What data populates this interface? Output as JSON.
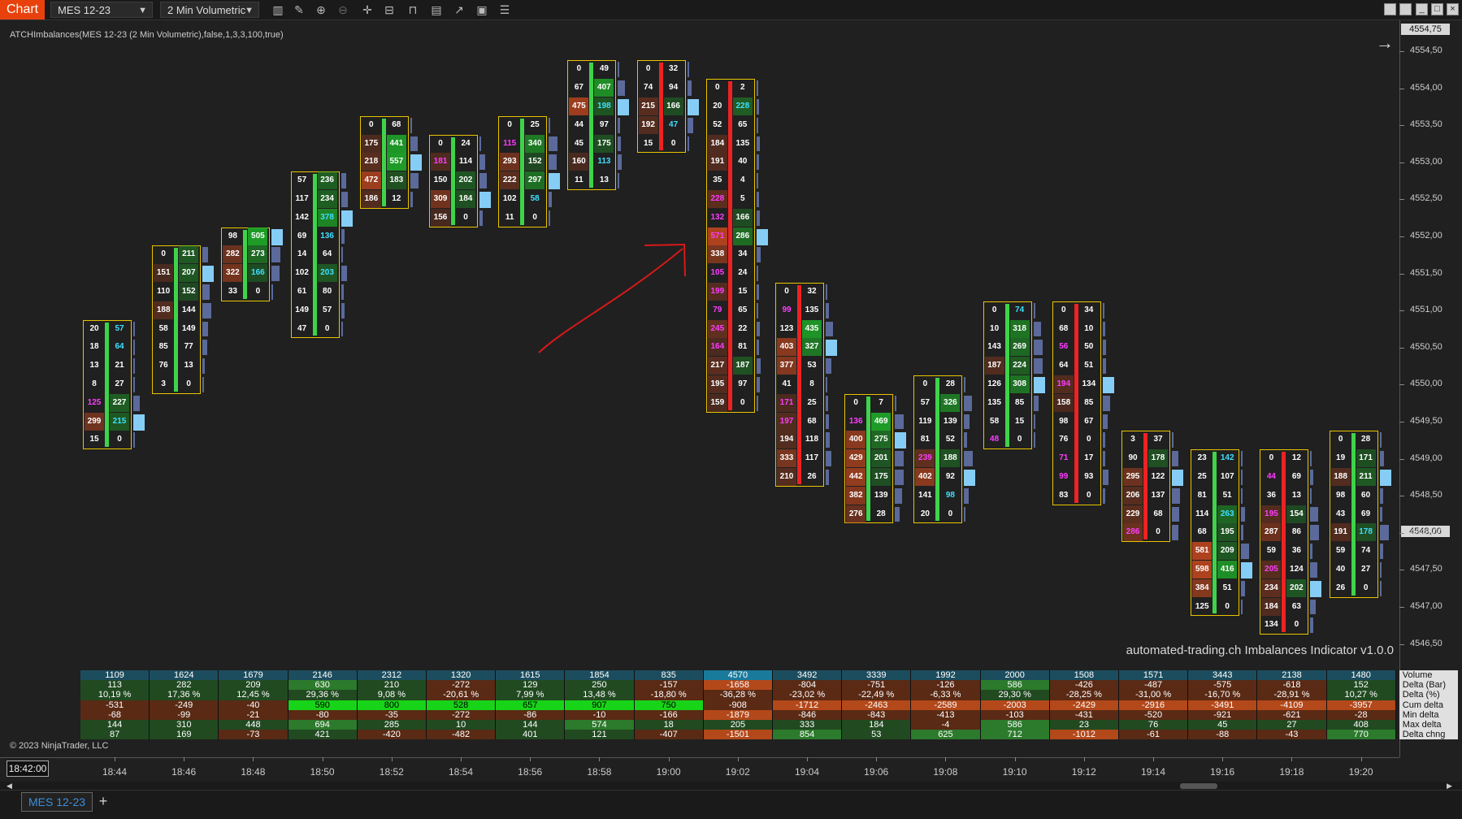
{
  "toolbar": {
    "tab_label": "Chart",
    "instrument": "MES 12-23",
    "bar_type": "2 Min Volumetric",
    "icons": [
      "bars-icon",
      "pencil-icon",
      "zoom-in-icon",
      "zoom-out-icon",
      "crosshair-icon",
      "data-box-icon",
      "bar-type-icon",
      "volumetric-icon",
      "strategy-icon",
      "indicators-icon",
      "properties-icon"
    ]
  },
  "chart": {
    "indicator_label": "ATCHImbalances(MES 12-23 (2 Min Volumetric),false,1,3,3,100,true)",
    "copyright": "© 2023 NinjaTrader, LLC",
    "watermark": "automated-trading.ch Imbalances Indicator v1.0.0",
    "price_labels": [
      "4554,50",
      "4554,00",
      "4553,50",
      "4553,00",
      "4552,50",
      "4552,00",
      "4551,50",
      "4551,00",
      "4550,50",
      "4550,00",
      "4549,50",
      "4549,00",
      "4548,50",
      "4548,00",
      "4547,50",
      "4547,00",
      "4546,50"
    ],
    "price_top_box": "4554,75",
    "price_current_box": "4548,00",
    "time_labels": [
      "18:44",
      "18:46",
      "18:48",
      "18:50",
      "18:52",
      "18:54",
      "18:56",
      "18:58",
      "19:00",
      "19:02",
      "19:04",
      "19:06",
      "19:08",
      "19:10",
      "19:12",
      "19:14",
      "19:16",
      "19:18",
      "19:20"
    ],
    "crosshair_time": "18:42:00",
    "bottom_tab": "MES 12-23",
    "add_tab": "+"
  },
  "chart_data": {
    "type": "table",
    "bars": [
      {
        "time": "18:44",
        "top": 4550.75,
        "dir": "up",
        "rows": [
          [
            "20",
            "57"
          ],
          [
            "18",
            "64"
          ],
          [
            "13",
            "21"
          ],
          [
            "8",
            "27"
          ],
          [
            "125",
            "227"
          ],
          [
            "299",
            "215"
          ],
          [
            "15",
            "0"
          ]
        ]
      },
      {
        "time": "18:46",
        "top": 4551.75,
        "dir": "up",
        "rows": [
          [
            "0",
            "211"
          ],
          [
            "151",
            "207"
          ],
          [
            "110",
            "152"
          ],
          [
            "188",
            "144"
          ],
          [
            "58",
            "149"
          ],
          [
            "85",
            "77"
          ],
          [
            "76",
            "13"
          ],
          [
            "3",
            "0"
          ]
        ]
      },
      {
        "time": "18:48",
        "top": 4552.0,
        "dir": "up",
        "rows": [
          [
            "98",
            "505"
          ],
          [
            "282",
            "273"
          ],
          [
            "322",
            "166"
          ],
          [
            "33",
            "0"
          ]
        ]
      },
      {
        "time": "18:50",
        "top": 4552.75,
        "dir": "up",
        "rows": [
          [
            "57",
            "236"
          ],
          [
            "117",
            "234"
          ],
          [
            "142",
            "378"
          ],
          [
            "69",
            "136"
          ],
          [
            "14",
            "64"
          ],
          [
            "102",
            "203"
          ],
          [
            "61",
            "80"
          ],
          [
            "149",
            "57"
          ],
          [
            "47",
            "0"
          ]
        ]
      },
      {
        "time": "18:52",
        "top": 4553.5,
        "dir": "up",
        "rows": [
          [
            "0",
            "68"
          ],
          [
            "175",
            "441"
          ],
          [
            "218",
            "557"
          ],
          [
            "472",
            "183"
          ],
          [
            "186",
            "12"
          ]
        ]
      },
      {
        "time": "18:54",
        "top": 4553.25,
        "dir": "up",
        "rows": [
          [
            "0",
            "24"
          ],
          [
            "181",
            "114"
          ],
          [
            "150",
            "202"
          ],
          [
            "309",
            "184"
          ],
          [
            "156",
            "0"
          ]
        ]
      },
      {
        "time": "18:56",
        "top": 4553.5,
        "dir": "up",
        "rows": [
          [
            "0",
            "25"
          ],
          [
            "115",
            "340"
          ],
          [
            "293",
            "152"
          ],
          [
            "222",
            "297"
          ],
          [
            "102",
            "58"
          ],
          [
            "11",
            "0"
          ]
        ]
      },
      {
        "time": "18:58",
        "top": 4554.25,
        "dir": "up",
        "rows": [
          [
            "0",
            "49"
          ],
          [
            "67",
            "407"
          ],
          [
            "475",
            "198"
          ],
          [
            "44",
            "97"
          ],
          [
            "45",
            "175"
          ],
          [
            "160",
            "113"
          ],
          [
            "11",
            "13"
          ]
        ]
      },
      {
        "time": "19:00",
        "top": 4554.25,
        "dir": "down",
        "rows": [
          [
            "0",
            "32"
          ],
          [
            "74",
            "94"
          ],
          [
            "215",
            "166"
          ],
          [
            "192",
            "47"
          ],
          [
            "15",
            "0"
          ]
        ]
      },
      {
        "time": "19:02",
        "top": 4554.0,
        "dir": "down",
        "rows": [
          [
            "0",
            "2"
          ],
          [
            "20",
            "228"
          ],
          [
            "52",
            "65"
          ],
          [
            "184",
            "135"
          ],
          [
            "191",
            "40"
          ],
          [
            "35",
            "4"
          ],
          [
            "228",
            "5"
          ],
          [
            "132",
            "166"
          ],
          [
            "571",
            "286"
          ],
          [
            "338",
            "34"
          ],
          [
            "105",
            "24"
          ],
          [
            "199",
            "15"
          ],
          [
            "79",
            "65"
          ],
          [
            "245",
            "22"
          ],
          [
            "164",
            "81"
          ],
          [
            "217",
            "187"
          ],
          [
            "195",
            "97"
          ],
          [
            "159",
            "0"
          ]
        ]
      },
      {
        "time": "19:04",
        "top": 4551.25,
        "dir": "down",
        "rows": [
          [
            "0",
            "32"
          ],
          [
            "99",
            "135"
          ],
          [
            "123",
            "435"
          ],
          [
            "403",
            "327"
          ],
          [
            "377",
            "53"
          ],
          [
            "41",
            "8"
          ],
          [
            "171",
            "25"
          ],
          [
            "197",
            "68"
          ],
          [
            "194",
            "118"
          ],
          [
            "333",
            "117"
          ],
          [
            "210",
            "26"
          ]
        ]
      },
      {
        "time": "19:06",
        "top": 4549.75,
        "dir": "up",
        "rows": [
          [
            "0",
            "7"
          ],
          [
            "136",
            "469"
          ],
          [
            "400",
            "275"
          ],
          [
            "429",
            "201"
          ],
          [
            "442",
            "175"
          ],
          [
            "382",
            "139"
          ],
          [
            "276",
            "28"
          ]
        ]
      },
      {
        "time": "19:08",
        "top": 4550.0,
        "dir": "up",
        "rows": [
          [
            "0",
            "28"
          ],
          [
            "57",
            "326"
          ],
          [
            "119",
            "139"
          ],
          [
            "81",
            "52"
          ],
          [
            "239",
            "188"
          ],
          [
            "402",
            "92"
          ],
          [
            "141",
            "98"
          ],
          [
            "20",
            "0"
          ]
        ]
      },
      {
        "time": "19:10",
        "top": 4551.0,
        "dir": "up",
        "rows": [
          [
            "0",
            "74"
          ],
          [
            "10",
            "318"
          ],
          [
            "143",
            "269"
          ],
          [
            "187",
            "224"
          ],
          [
            "126",
            "308"
          ],
          [
            "135",
            "85"
          ],
          [
            "58",
            "15"
          ],
          [
            "48",
            "0"
          ]
        ]
      },
      {
        "time": "19:12",
        "top": 4551.0,
        "dir": "down",
        "rows": [
          [
            "0",
            "34"
          ],
          [
            "68",
            "10"
          ],
          [
            "56",
            "50"
          ],
          [
            "64",
            "51"
          ],
          [
            "194",
            "134"
          ],
          [
            "158",
            "85"
          ],
          [
            "98",
            "67"
          ],
          [
            "76",
            "0"
          ],
          [
            "71",
            "17"
          ],
          [
            "99",
            "93"
          ],
          [
            "83",
            "0"
          ]
        ]
      },
      {
        "time": "19:14",
        "top": 4549.25,
        "dir": "down",
        "rows": [
          [
            "3",
            "37"
          ],
          [
            "90",
            "178"
          ],
          [
            "295",
            "122"
          ],
          [
            "206",
            "137"
          ],
          [
            "229",
            "68"
          ],
          [
            "286",
            "0"
          ]
        ]
      },
      {
        "time": "19:16",
        "top": 4549.0,
        "dir": "up",
        "rows": [
          [
            "23",
            "142"
          ],
          [
            "25",
            "107"
          ],
          [
            "81",
            "51"
          ],
          [
            "114",
            "263"
          ],
          [
            "68",
            "195"
          ],
          [
            "581",
            "209"
          ],
          [
            "598",
            "416"
          ],
          [
            "384",
            "51"
          ],
          [
            "125",
            "0"
          ]
        ]
      },
      {
        "time": "19:18",
        "top": 4549.0,
        "dir": "down",
        "rows": [
          [
            "0",
            "12"
          ],
          [
            "44",
            "69"
          ],
          [
            "36",
            "13"
          ],
          [
            "195",
            "154"
          ],
          [
            "287",
            "86"
          ],
          [
            "59",
            "36"
          ],
          [
            "205",
            "124"
          ],
          [
            "234",
            "202"
          ],
          [
            "184",
            "63"
          ],
          [
            "134",
            "0"
          ]
        ]
      },
      {
        "time": "19:20",
        "top": 4549.25,
        "dir": "up",
        "rows": [
          [
            "0",
            "28"
          ],
          [
            "19",
            "171"
          ],
          [
            "188",
            "211"
          ],
          [
            "98",
            "60"
          ],
          [
            "43",
            "69"
          ],
          [
            "191",
            "178"
          ],
          [
            "59",
            "74"
          ],
          [
            "40",
            "27"
          ],
          [
            "26",
            "0"
          ]
        ]
      }
    ],
    "summary": {
      "labels": [
        "Volume",
        "Delta (Bar)",
        "Delta (%)",
        "Cum delta",
        "Min delta",
        "Max delta",
        "Delta chng"
      ],
      "volume": [
        "1109",
        "1624",
        "1679",
        "2146",
        "2312",
        "1320",
        "1615",
        "1854",
        "835",
        "4570",
        "3492",
        "3339",
        "1992",
        "2000",
        "1508",
        "1571",
        "3443",
        "2138",
        "1480"
      ],
      "delta_bar": [
        "113",
        "282",
        "209",
        "630",
        "210",
        "-272",
        "129",
        "250",
        "-157",
        "-1658",
        "-804",
        "-751",
        "-126",
        "586",
        "-426",
        "-487",
        "-575",
        "-618",
        "152"
      ],
      "delta_pct": [
        "10,19 %",
        "17,36 %",
        "12,45 %",
        "29,36 %",
        "9,08 %",
        "-20,61 %",
        "7,99 %",
        "13,48 %",
        "-18,80 %",
        "-36,28 %",
        "-23,02 %",
        "-22,49 %",
        "-6,33 %",
        "29,30 %",
        "-28,25 %",
        "-31,00 %",
        "-16,70 %",
        "-28,91 %",
        "10,27 %"
      ],
      "cum_delta": [
        "-531",
        "-249",
        "-40",
        "590",
        "800",
        "528",
        "657",
        "907",
        "750",
        "-908",
        "-1712",
        "-2463",
        "-2589",
        "-2003",
        "-2429",
        "-2916",
        "-3491",
        "-4109",
        "-3957"
      ],
      "min_delta": [
        "-68",
        "-99",
        "-21",
        "-80",
        "-35",
        "-272",
        "-86",
        "-10",
        "-166",
        "-1879",
        "-846",
        "-843",
        "-413",
        "-103",
        "-431",
        "-520",
        "-921",
        "-621",
        "-28"
      ],
      "max_delta": [
        "144",
        "310",
        "448",
        "694",
        "285",
        "10",
        "144",
        "574",
        "18",
        "205",
        "333",
        "184",
        "-4",
        "586",
        "23",
        "76",
        "45",
        "27",
        "408"
      ],
      "delta_chng": [
        "87",
        "169",
        "-73",
        "421",
        "-420",
        "-482",
        "401",
        "121",
        "-407",
        "-1501",
        "854",
        "53",
        "625",
        "712",
        "-1012",
        "-61",
        "-88",
        "-43",
        "770"
      ]
    }
  }
}
